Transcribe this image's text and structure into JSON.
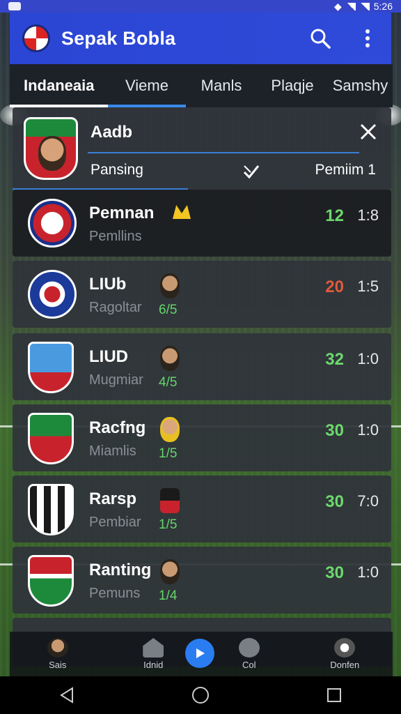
{
  "status_bar": {
    "time": "5:26"
  },
  "app": {
    "title": "Sepak Bobla"
  },
  "tabs": [
    {
      "label": "Indaneaia",
      "active": true
    },
    {
      "label": "Vieme"
    },
    {
      "label": "Manls"
    },
    {
      "label": "Plaqje"
    },
    {
      "label": "Samshy"
    }
  ],
  "search_card": {
    "name": "Aadb",
    "filter_label": "Pansing",
    "filter_value": "Pemiim 1"
  },
  "matches": [
    {
      "title": "Pemnan",
      "sub": "Pemllins",
      "ratio": "",
      "score": "12",
      "score_color": "#6cd96d",
      "time": "1:8"
    },
    {
      "title": "LIUb",
      "sub": "Ragoltar",
      "ratio": "6/5",
      "score": "20",
      "score_color": "#e05a3a",
      "time": "1:5"
    },
    {
      "title": "LIUD",
      "sub": "Mugmiar",
      "ratio": "4/5",
      "score": "32",
      "score_color": "#6cd96d",
      "time": "1:0"
    },
    {
      "title": "Racfng",
      "sub": "Miamlis",
      "ratio": "1/5",
      "score": "30",
      "score_color": "#6cd96d",
      "time": "1:0"
    },
    {
      "title": "Rarsp",
      "sub": "Pembiar",
      "ratio": "1/5",
      "score": "30",
      "score_color": "#6cd96d",
      "time": "7:0"
    },
    {
      "title": "Ranting",
      "sub": "Pemuns",
      "ratio": "1/4",
      "score": "30",
      "score_color": "#6cd96d",
      "time": "1:0"
    }
  ],
  "bottom_nav": [
    {
      "label": "Sais",
      "icon": "avatar-icon"
    },
    {
      "label": "Idnid",
      "icon": "home-icon"
    },
    {
      "label": "Col",
      "icon": "chat-icon"
    },
    {
      "label": "Donfen",
      "icon": "ball-icon"
    }
  ],
  "colors": {
    "app_bar": "#2f4ad8",
    "accent": "#2a7df0",
    "score_green": "#6cd96d",
    "score_red": "#e05a3a"
  }
}
